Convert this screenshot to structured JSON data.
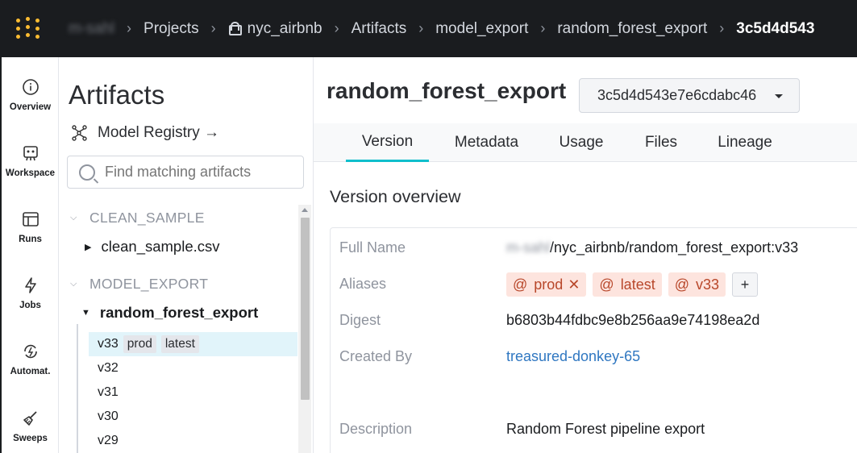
{
  "header": {
    "user": "m-sahl",
    "crumbs": [
      "Projects",
      "nyc_airbnb",
      "Artifacts",
      "model_export",
      "random_forest_export",
      "3c5d4d543"
    ]
  },
  "nav": [
    {
      "label": "Overview",
      "icon": "info-icon"
    },
    {
      "label": "Workspace",
      "icon": "workspace-icon"
    },
    {
      "label": "Runs",
      "icon": "table-icon"
    },
    {
      "label": "Jobs",
      "icon": "lightning-icon"
    },
    {
      "label": "Automat.",
      "icon": "automation-icon"
    },
    {
      "label": "Sweeps",
      "icon": "broom-icon"
    }
  ],
  "sidebar": {
    "title": "Artifacts",
    "registry_link": "Model Registry →",
    "search_placeholder": "Find matching artifacts",
    "sections": [
      {
        "name": "CLEAN_SAMPLE",
        "items": [
          "clean_sample.csv"
        ]
      },
      {
        "name": "MODEL_EXPORT",
        "items": [
          "random_forest_export"
        ]
      }
    ],
    "versions": [
      {
        "label": "v33",
        "tags": [
          "prod",
          "latest"
        ]
      },
      {
        "label": "v32"
      },
      {
        "label": "v31"
      },
      {
        "label": "v30"
      },
      {
        "label": "v29"
      }
    ]
  },
  "main": {
    "title": "random_forest_export",
    "version_select": "3c5d4d543e7e6cdabc46",
    "tabs": [
      "Version",
      "Metadata",
      "Usage",
      "Files",
      "Lineage"
    ],
    "active_tab": "Version",
    "section_title": "Version overview",
    "fields": {
      "full_name_label": "Full Name",
      "full_name_user": "m-sahl",
      "full_name_rest": "/nyc_airbnb/random_forest_export:v33",
      "aliases_label": "Aliases",
      "aliases": [
        "prod",
        "latest",
        "v33"
      ],
      "add_alias": "+",
      "digest_label": "Digest",
      "digest": "b6803b44fdbc9e8b256aa9e74198ea2d",
      "created_by_label": "Created By",
      "created_by": "treasured-donkey-65",
      "description_label": "Description",
      "description": "Random Forest pipeline export"
    }
  },
  "colors": {
    "topbar": "#1a1c1f",
    "accent": "#10bfcc",
    "alias_bg": "#fde4de",
    "alias_fg": "#b8472a",
    "link": "#2f77c1",
    "logo": "#fcbc32"
  }
}
